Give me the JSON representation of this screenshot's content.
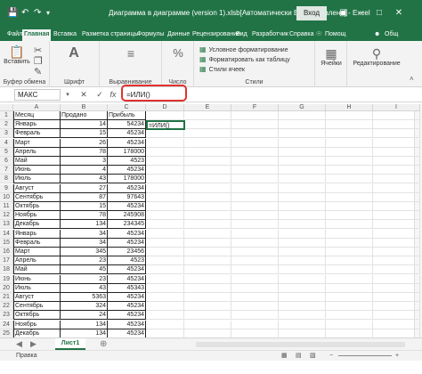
{
  "titlebar": {
    "title": "Диаграмма в диаграмме (version 1).xlsb[Автоматически Восстановлено]  -  Excel",
    "signin": "Вход",
    "autosave_icon": "save-icon",
    "undo_icon": "undo-icon",
    "redo_icon": "redo-icon"
  },
  "ribbon_tabs": [
    "Файл",
    "Главная",
    "Вставка",
    "Разметка страницы",
    "Формулы",
    "Данные",
    "Рецензирование",
    "Вид",
    "Разработчик",
    "Справка"
  ],
  "ribbon_extra": {
    "help": "Помощ",
    "share": "Общ"
  },
  "ribbon": {
    "paste": "Вставить",
    "clipboard": "Буфер обмена",
    "font": "Шрифт",
    "alignment": "Выравнивание",
    "number_sign": "%",
    "number": "Число",
    "conditional": "Условное форматирование",
    "as_table": "Форматировать как таблицу",
    "cell_styles": "Стили ячеек",
    "styles": "Стили",
    "cells": "Ячейки",
    "editing": "Редактирование"
  },
  "formula_bar": {
    "name_box": "МАКС",
    "cancel": "✕",
    "enter": "✓",
    "fx": "fx",
    "formula": "=ИЛИ()"
  },
  "columns": [
    "A",
    "B",
    "C",
    "D",
    "E",
    "F",
    "G",
    "H",
    "I"
  ],
  "table": {
    "headers": [
      "Месяц",
      "Продано",
      "Прибыль"
    ],
    "rows": [
      [
        "Январь",
        "14",
        "54234"
      ],
      [
        "Февраль",
        "15",
        "45234"
      ],
      [
        "Март",
        "26",
        "45234"
      ],
      [
        "Апрель",
        "78",
        "178000"
      ],
      [
        "Май",
        "3",
        "4523"
      ],
      [
        "Июнь",
        "4",
        "45234"
      ],
      [
        "Июль",
        "43",
        "178000"
      ],
      [
        "Август",
        "27",
        "45234"
      ],
      [
        "Сентябрь",
        "87",
        "97643"
      ],
      [
        "Октябрь",
        "15",
        "45234"
      ],
      [
        "Ноябрь",
        "78",
        "245908"
      ],
      [
        "Декабрь",
        "134",
        "234345"
      ],
      [
        "Январь",
        "34",
        "45234"
      ],
      [
        "Февраль",
        "34",
        "45234"
      ],
      [
        "Март",
        "345",
        "23456"
      ],
      [
        "Апрель",
        "23",
        "4523"
      ],
      [
        "Май",
        "45",
        "45234"
      ],
      [
        "Июнь",
        "23",
        "45234"
      ],
      [
        "Июль",
        "43",
        "45343"
      ],
      [
        "Август",
        "5363",
        "45234"
      ],
      [
        "Сентябрь",
        "324",
        "45234"
      ],
      [
        "Октябрь",
        "24",
        "45234"
      ],
      [
        "Ноябрь",
        "134",
        "45234"
      ],
      [
        "Декабрь",
        "134",
        "45234"
      ]
    ]
  },
  "active_cell_value": "=ИЛИ()",
  "row_numbers": [
    "1",
    "2",
    "3",
    "4",
    "5",
    "6",
    "7",
    "8",
    "9",
    "10",
    "11",
    "12",
    "13",
    "14",
    "15",
    "16",
    "17",
    "18",
    "19",
    "20",
    "21",
    "22",
    "23",
    "24",
    "25"
  ],
  "sheet_tab": "Лист1",
  "status": "Правка",
  "accent_color": "#217346",
  "highlight_color": "#e0312e"
}
